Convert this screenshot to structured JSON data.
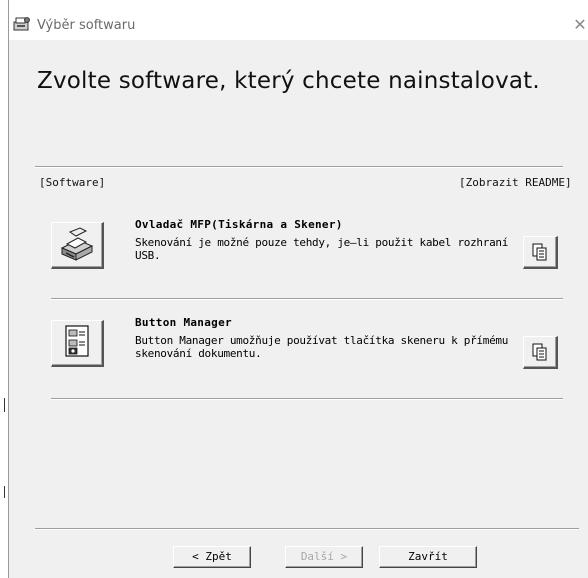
{
  "window": {
    "title": "Výběr softwaru",
    "close_glyph": "✕",
    "heading": "Zvolte software, který chcete nainstalovat."
  },
  "section": {
    "left_label": "[Software]",
    "right_label": "[Zobrazit README]"
  },
  "items": [
    {
      "title": "Ovladač MFP(Tiskárna a Skener)",
      "desc_line1": "Skenování je možné pouze tehdy, je–li použit kabel rozhraní",
      "desc_line2": "USB.",
      "icon": "printer-scanner-icon"
    },
    {
      "title": "Button Manager",
      "desc_line1": "Button Manager umožňuje používat tlačítka skeneru k přímému",
      "desc_line2": "skenování dokumentu.",
      "icon": "button-manager-icon"
    }
  ],
  "footer": {
    "back": "< Zpět",
    "next": "Další >",
    "close": "Zavřít"
  },
  "colors": {
    "window_bg": "#f0f0f0",
    "titlebar_bg": "#ffffff",
    "disabled_text": "#a8a8a8"
  }
}
